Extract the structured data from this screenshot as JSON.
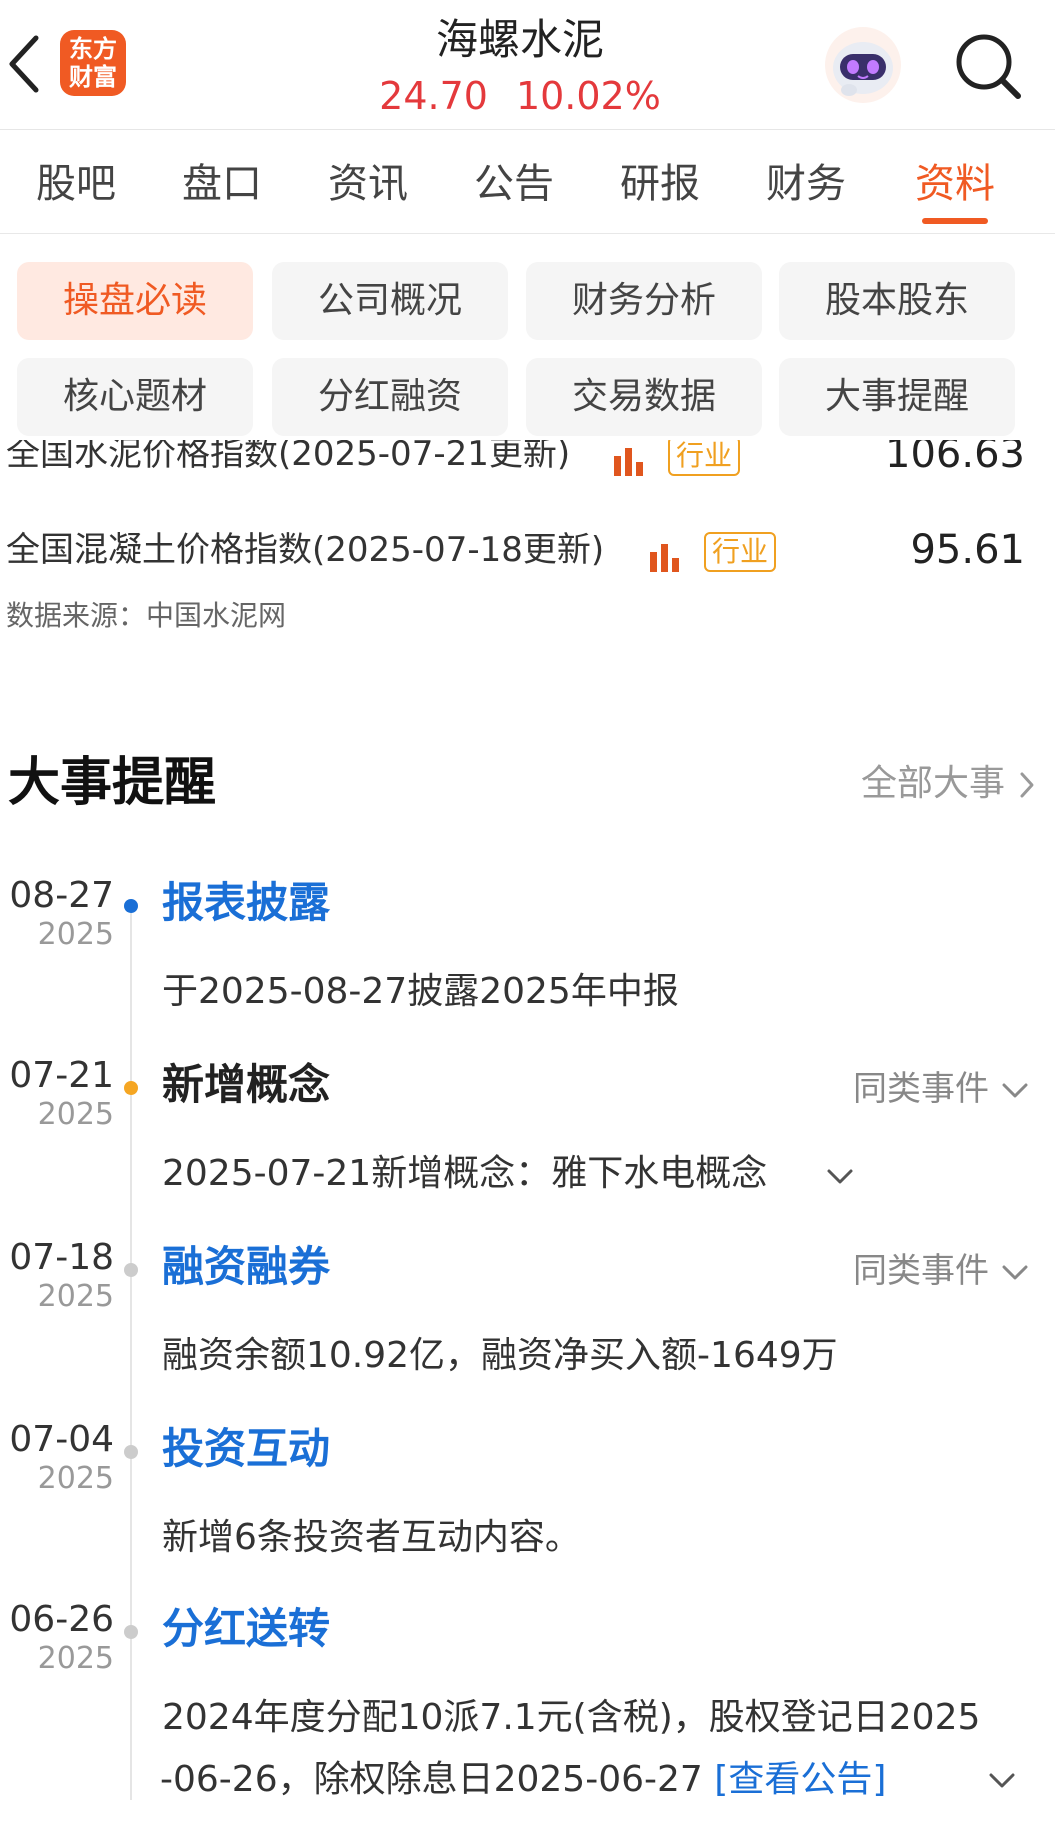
{
  "header": {
    "logo_line1": "东方",
    "logo_line2": "财富",
    "stock_name": "海螺水泥",
    "price": "24.70",
    "change_pct": "10.02%",
    "price_color": "#e4393c",
    "icons": {
      "back": "back-arrow-icon",
      "assistant": "robot-avatar-icon",
      "search": "search-icon"
    }
  },
  "tabs": [
    "股吧",
    "盘口",
    "资讯",
    "公告",
    "研报",
    "财务",
    "资料"
  ],
  "active_tab": "资料",
  "accent_color": "#f05a23",
  "chips": [
    "操盘必读",
    "公司概况",
    "财务分析",
    "股本股东",
    "核心题材",
    "分红融资",
    "交易数据",
    "大事提醒"
  ],
  "active_chip": "操盘必读",
  "indices": [
    {
      "label": "全国水泥价格指数(2025-07-21更新)",
      "tag": "行业",
      "value": "106.63"
    },
    {
      "label": "全国混凝土价格指数(2025-07-18更新)",
      "tag": "行业",
      "value": "95.61"
    }
  ],
  "source": "数据来源：中国水泥网",
  "events_section": {
    "title": "大事提醒",
    "more": "全部大事",
    "same_label": "同类事件",
    "events": [
      {
        "md": "08-27",
        "year": "2025",
        "title": "报表披露",
        "body": "于2025-08-27披露2025年中报"
      },
      {
        "md": "07-21",
        "year": "2025",
        "title": "新增概念",
        "body": "2025-07-21新增概念：雅下水电概念"
      },
      {
        "md": "07-18",
        "year": "2025",
        "title": "融资融券",
        "body": "融资余额10.92亿，融资净买入额-1649万"
      },
      {
        "md": "07-04",
        "year": "2025",
        "title": "投资互动",
        "body": "新增6条投资者互动内容。"
      },
      {
        "md": "06-26",
        "year": "2025",
        "title": "分红送转",
        "body_line1": "2024年度分配10派7.1元(含税)，股权登记日2025",
        "body_line2": "-06-26，除权除息日2025-06-27",
        "link": "[查看公告]"
      }
    ]
  }
}
